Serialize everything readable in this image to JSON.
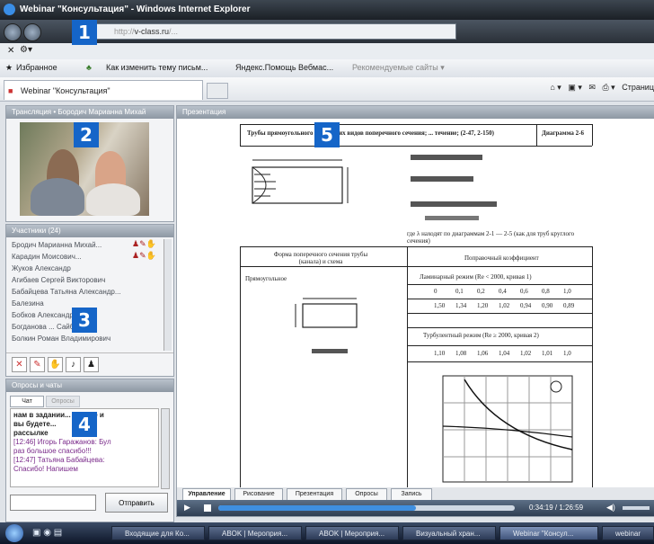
{
  "window": {
    "title": "Webinar \"Консультация\" - Windows Internet Explorer"
  },
  "address": {
    "host": "v-class.ru"
  },
  "favorites": {
    "label": "Избранное",
    "items": [
      "Как изменить тему письм...",
      "Яндекс.Помощь Вебмас...",
      "Рекомендуемые сайты ▾"
    ]
  },
  "tab": {
    "label": "Webinar \"Консультация\"",
    "tools": "Страниц"
  },
  "left": {
    "video_header": "Трансляция • Бородич Марианна Михай",
    "participants_header": "Участники (24)",
    "participants": [
      "Бродич Марианна Михай...",
      "Карадин Моисович...",
      "Жуков Александр",
      "Агибаев Сергей Викторович",
      "Бабайцева Татьяна Александр...",
      "Балезина",
      "Бобков Александр...",
      "Богданова ... Сайбовна",
      "Болкин Роман Владимирович"
    ],
    "chat_header": "Опросы и чаты",
    "chat_tabs": [
      "Чат",
      "Опросы"
    ],
    "chat_lines": [
      "нам в задании... Будете и",
      "вы будете...",
      "рассылке",
      "[12:46] Игорь Гаражанов: Бул",
      "раз большое спасибо!!!",
      "[12:47] Татьяна Бабайцева:",
      "Спасибо! Напишем"
    ],
    "send_label": "Отправить"
  },
  "main": {
    "header": "Презентация",
    "doc_title": "Трубы прямоугольного ... и других видов поперечного сечения; ... течение; (2-47, 2-150)",
    "doc_diagram_label": "Диаграмма 2-6",
    "col_left_head": "Форма поперечного сечения трубы (канала) и схема",
    "col_right_head": "Поправочный коэффициент",
    "shape_label": "Прямоугольное",
    "laminar_label": "Ламинарный режим (Re < 2000, кривая 1)",
    "turbulent_label": "Турбулентный режим (Re ≥ 2000, кривая 2)",
    "note": "где λ находят по диаграммам 2-1 — 2-5 (как для труб круглого сечения)",
    "ratio_row": [
      "0",
      "0,1",
      "0,2",
      "0,4",
      "0,6",
      "0,8",
      "1,0"
    ],
    "laminar_row": [
      "1,50",
      "1,34",
      "1,20",
      "1,02",
      "0,94",
      "0,90",
      "0,89"
    ],
    "turbulent_row": [
      "1,10",
      "1,08",
      "1,06",
      "1,04",
      "1,02",
      "1,01",
      "1,0"
    ],
    "bottom_tabs": [
      "Управление",
      "Рисование",
      "Презентация",
      "Опросы",
      "Запись"
    ],
    "time": "0:34:19 / 1:26:59"
  },
  "taskbar": {
    "items": [
      "Входящие для Ко...",
      "ABOK | Мероприя...",
      "ABOK | Мероприя...",
      "Визуальный хран...",
      "Webinar \"Консул...",
      "webinar"
    ]
  },
  "badges": [
    "1",
    "2",
    "3",
    "4",
    "5"
  ]
}
